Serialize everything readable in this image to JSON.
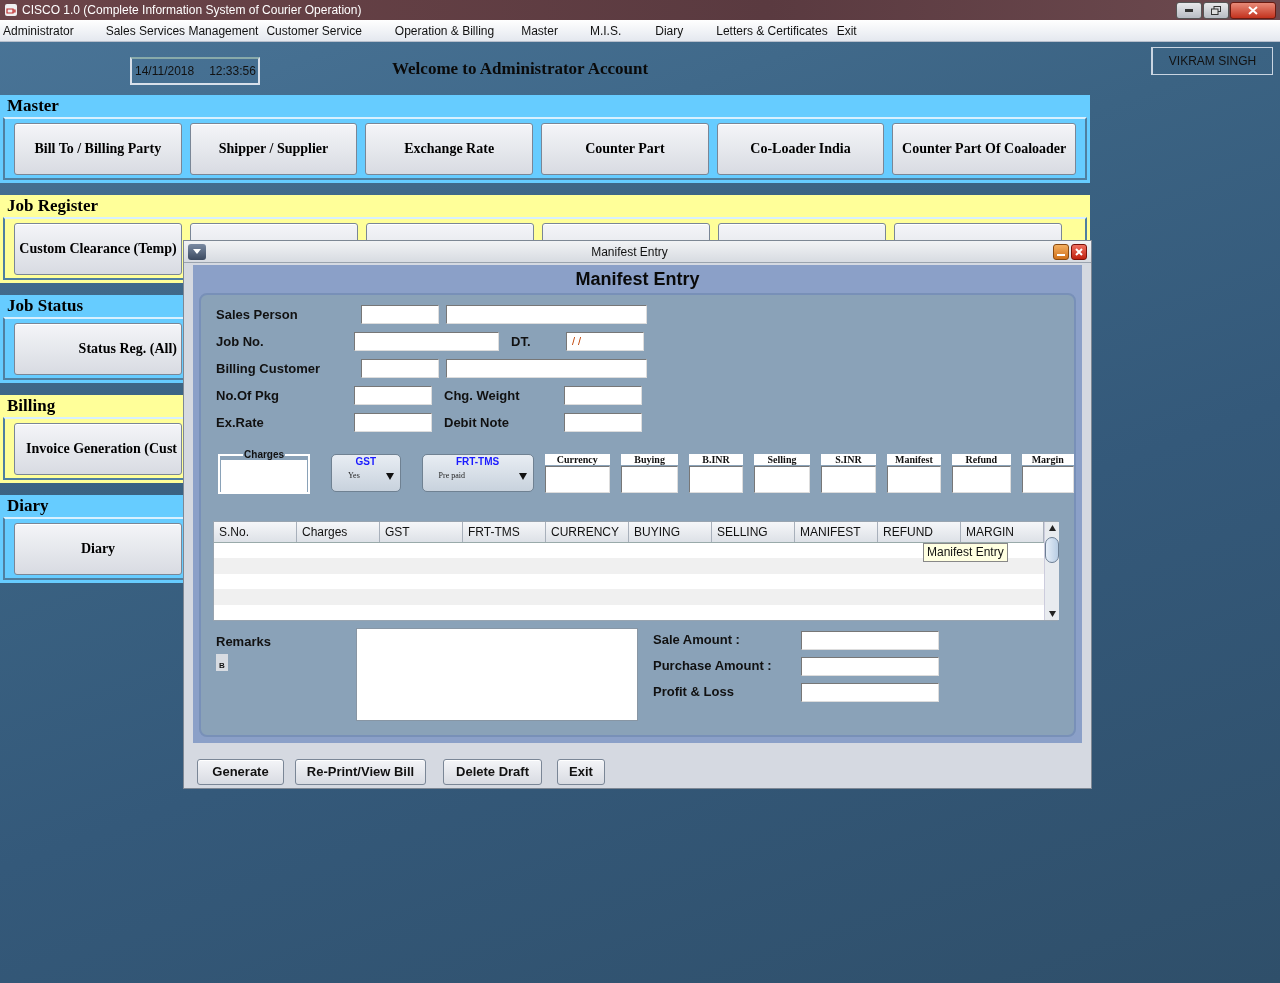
{
  "window": {
    "title": "CISCO 1.0 (Complete Information System of Courier Operation)"
  },
  "menu": [
    "Administrator",
    "Sales Services Management",
    "Customer Service",
    "Operation & Billing",
    "Master",
    "M.I.S.",
    "Diary",
    "Letters & Certificates",
    "Exit"
  ],
  "header": {
    "date": "14/11/2018",
    "time": "12:33:56",
    "welcome": "Welcome to Administrator Account",
    "user": "VIKRAM SINGH"
  },
  "sections": [
    {
      "title": "Master",
      "color": "#66ccff",
      "buttons": [
        "Bill To / Billing Party",
        "Shipper / Supplier",
        "Exchange Rate",
        "Counter Part",
        "Co-Loader India",
        "Counter Part Of Coaloader"
      ]
    },
    {
      "title": "Job Register",
      "color": "#ffff99",
      "buttons": [
        "Custom Clearance (Temp)"
      ]
    },
    {
      "title": "Job Status",
      "color": "#66ccff",
      "buttons": [
        "Status Reg. (All)"
      ]
    },
    {
      "title": "Billing",
      "color": "#ffff99",
      "buttons": [
        "Invoice Generation (Cust"
      ]
    },
    {
      "title": "Diary",
      "color": "#66ccff",
      "buttons": [
        "Diary"
      ]
    }
  ],
  "dialog": {
    "title": "Manifest Entry",
    "heading": "Manifest Entry",
    "rows": [
      {
        "kind": "pair",
        "label": "Sales Person"
      },
      {
        "kind": "long_split",
        "label": "Job No.",
        "label2": "DT.",
        "value2": "/ /"
      },
      {
        "kind": "pair",
        "label": "Billing Customer"
      },
      {
        "kind": "split",
        "label": "No.Of Pkg",
        "label2": "Chg. Weight"
      },
      {
        "kind": "split",
        "label": "Ex.Rate",
        "label2": "Debit Note"
      }
    ],
    "charges": [
      {
        "kind": "group",
        "label": "Charges"
      },
      {
        "kind": "combo",
        "label": "GST",
        "value": "Yes"
      },
      {
        "kind": "combo",
        "label": "FRT-TMS",
        "value": "Pre paid"
      },
      {
        "kind": "box",
        "label": "Currency"
      },
      {
        "kind": "box",
        "label": "Buying"
      },
      {
        "kind": "box",
        "label": "B.INR"
      },
      {
        "kind": "box",
        "label": "Selling"
      },
      {
        "kind": "box",
        "label": "S.INR"
      },
      {
        "kind": "box",
        "label": "Manifest"
      },
      {
        "kind": "box",
        "label": "Refund"
      },
      {
        "kind": "box",
        "label": "Margin"
      }
    ],
    "columns": [
      "S.No.",
      "Charges",
      "GST",
      "FRT-TMS",
      "CURRENCY",
      "BUYING",
      "SELLING",
      "MANIFEST",
      "REFUND",
      "MARGIN"
    ],
    "tooltip": "Manifest Entry",
    "remarks": {
      "label": "Remarks",
      "button": "B"
    },
    "totals": [
      "Sale Amount :",
      "Purchase Amount :",
      "Profit & Loss"
    ],
    "buttons": [
      "Generate",
      "Re-Print/View Bill",
      "Delete Draft",
      "Exit"
    ]
  }
}
